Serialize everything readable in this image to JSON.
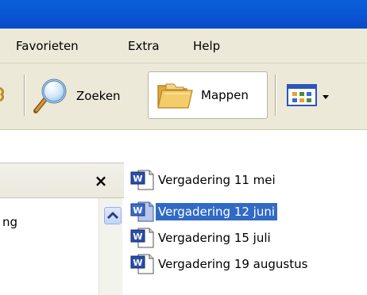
{
  "menubar": {
    "items": [
      {
        "label": "Favorieten"
      },
      {
        "label": "Extra"
      },
      {
        "label": "Help"
      }
    ]
  },
  "toolbar": {
    "search_label": "Zoeken",
    "folders_label": "Mappen",
    "view_icon": "view-thumbnails-icon"
  },
  "folder_pane": {
    "close_symbol": "×",
    "partial_tree_text": "ng"
  },
  "files": [
    {
      "name": "Vergadering 11 mei",
      "selected": false
    },
    {
      "name": "Vergadering 12 juni",
      "selected": true
    },
    {
      "name": "Vergadering 15 juli",
      "selected": false
    },
    {
      "name": "Vergadering 19 augustus",
      "selected": false
    }
  ],
  "colors": {
    "title_bar": "#0a57d6",
    "chrome": "#ece9d8",
    "selection": "#316ac5",
    "word_blue": "#2b4fa8"
  }
}
